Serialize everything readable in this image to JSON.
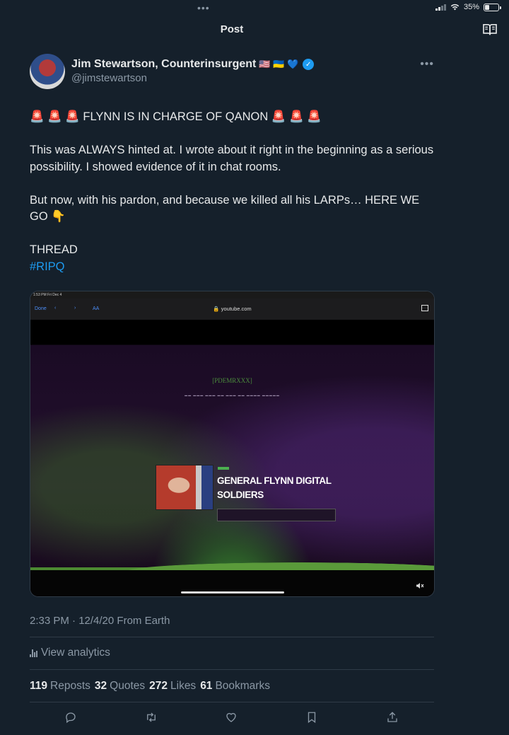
{
  "status_bar": {
    "battery_text": "35%",
    "battery_level": 0.35
  },
  "header": {
    "title": "Post"
  },
  "author": {
    "name": "Jim Stewartson, Counterinsurgent",
    "badges": "🇺🇸 🇺🇦 💙",
    "handle": "@jimstewartson"
  },
  "tweet": {
    "line1": "🚨 🚨 🚨  FLYNN IS IN CHARGE OF QANON 🚨 🚨 🚨",
    "para2": "This was ALWAYS hinted at. I wrote about it right in the beginning as a serious possibility. I showed evidence of it in chat rooms.",
    "para3": "But now, with his pardon, and because we killed all his LARPs… HERE WE GO 👇",
    "thread": "THREAD",
    "hashtag": "#RIPQ"
  },
  "media": {
    "device_time": "1:53 PM  Fri Dec 4",
    "done_label": "Done",
    "aa_label": "AA",
    "url": "🔒 youtube.com",
    "site_logo": "[PDEMRXXX]",
    "card_title": "GENERAL FLYNN DIGITAL SOLDIERS"
  },
  "meta": {
    "timestamp": "2:33 PM · 12/4/20 From Earth",
    "analytics_label": "View analytics"
  },
  "stats": {
    "reposts_count": "119",
    "reposts_label": "Reposts",
    "quotes_count": "32",
    "quotes_label": "Quotes",
    "likes_count": "272",
    "likes_label": "Likes",
    "bookmarks_count": "61",
    "bookmarks_label": "Bookmarks"
  },
  "colors": {
    "background": "#15202b",
    "accent": "#1d9bf0",
    "secondary_text": "#8b98a5"
  },
  "icons": [
    "reader-icon",
    "more-icon",
    "verified-icon",
    "analytics-icon",
    "reply-icon",
    "retweet-icon",
    "like-icon",
    "bookmark-icon",
    "share-icon",
    "mute-icon"
  ]
}
